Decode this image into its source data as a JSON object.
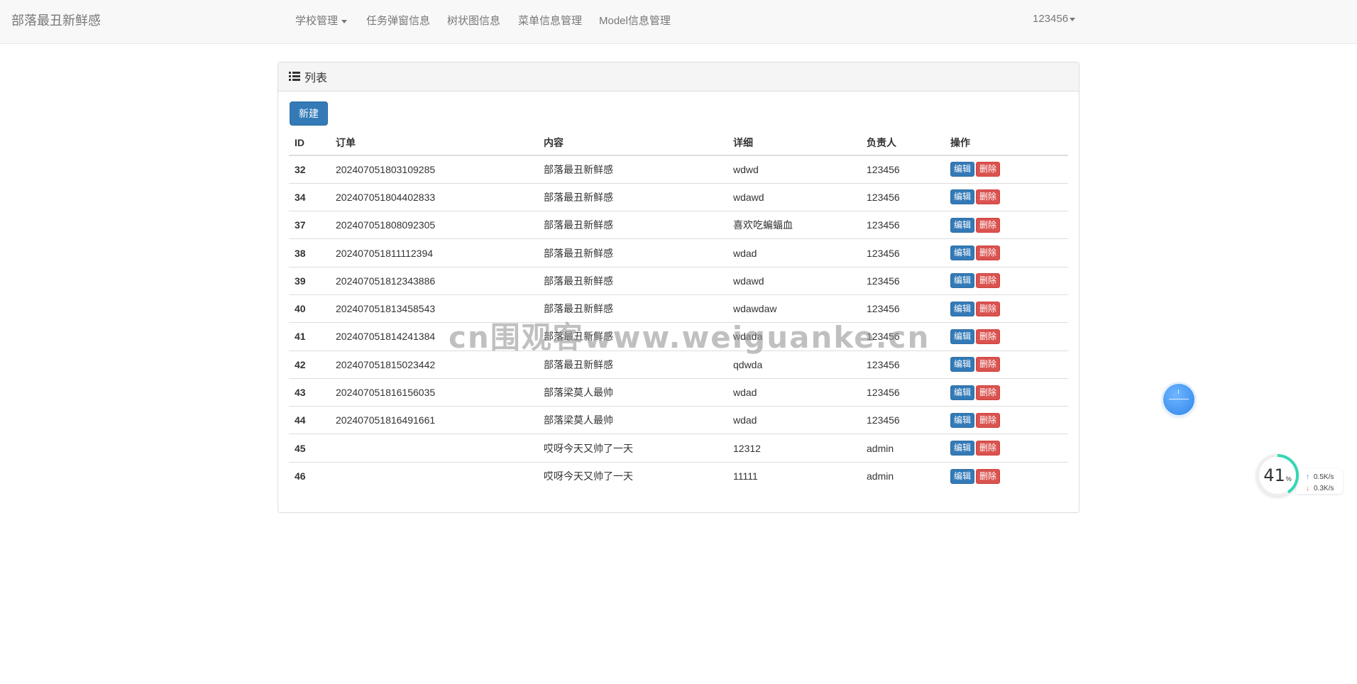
{
  "navbar": {
    "brand": "部落最丑新鲜感",
    "items": [
      {
        "label": "学校管理",
        "dropdown": true
      },
      {
        "label": "任务弹窗信息"
      },
      {
        "label": "树状图信息"
      },
      {
        "label": "菜单信息管理"
      },
      {
        "label": "Model信息管理"
      }
    ],
    "user": "123456"
  },
  "panel": {
    "title": "列表",
    "new_button": "新建",
    "columns": [
      "ID",
      "订单",
      "内容",
      "详细",
      "负责人",
      "操作"
    ],
    "edit_label": "编辑",
    "delete_label": "删除",
    "rows": [
      {
        "id": "32",
        "order": "202407051803109285",
        "content": "部落最丑新鲜感",
        "detail": "wdwd",
        "owner": "123456"
      },
      {
        "id": "34",
        "order": "202407051804402833",
        "content": "部落最丑新鲜感",
        "detail": "wdawd",
        "owner": "123456"
      },
      {
        "id": "37",
        "order": "202407051808092305",
        "content": "部落最丑新鲜感",
        "detail": "喜欢吃蝙蝠血",
        "owner": "123456"
      },
      {
        "id": "38",
        "order": "202407051811112394",
        "content": "部落最丑新鲜感",
        "detail": "wdad",
        "owner": "123456"
      },
      {
        "id": "39",
        "order": "202407051812343886",
        "content": "部落最丑新鲜感",
        "detail": "wdawd",
        "owner": "123456"
      },
      {
        "id": "40",
        "order": "202407051813458543",
        "content": "部落最丑新鲜感",
        "detail": "wdawdaw",
        "owner": "123456"
      },
      {
        "id": "41",
        "order": "202407051814241384",
        "content": "部落最丑新鲜感",
        "detail": "wdada",
        "owner": "123456"
      },
      {
        "id": "42",
        "order": "202407051815023442",
        "content": "部落最丑新鲜感",
        "detail": "qdwda",
        "owner": "123456"
      },
      {
        "id": "43",
        "order": "202407051816156035",
        "content": "部落梁莫人最帅",
        "detail": "wdad",
        "owner": "123456"
      },
      {
        "id": "44",
        "order": "202407051816491661",
        "content": "部落梁莫人最帅",
        "detail": "wdad",
        "owner": "123456"
      },
      {
        "id": "45",
        "order": "",
        "content": "哎呀今天又帅了一天",
        "detail": "12312",
        "owner": "admin"
      },
      {
        "id": "46",
        "order": "",
        "content": "哎呀今天又帅了一天",
        "detail": "11111",
        "owner": "admin"
      }
    ]
  },
  "watermark": "cn围观客www.weiguanke.cn",
  "speed_widget": {
    "percent": "41",
    "percent_unit": "%",
    "upload": "0.5K/s",
    "download": "0.3K/s",
    "ring_color": "#35d6b3"
  },
  "icons": {
    "list": "list-icon",
    "caret": "caret-down-icon",
    "float_ball": "assistant-ball-icon",
    "upload": "arrow-up-icon",
    "download": "arrow-down-icon"
  },
  "colors": {
    "primary": "#337ab7",
    "danger": "#d9534f",
    "navbar_bg": "#f8f8f8"
  }
}
